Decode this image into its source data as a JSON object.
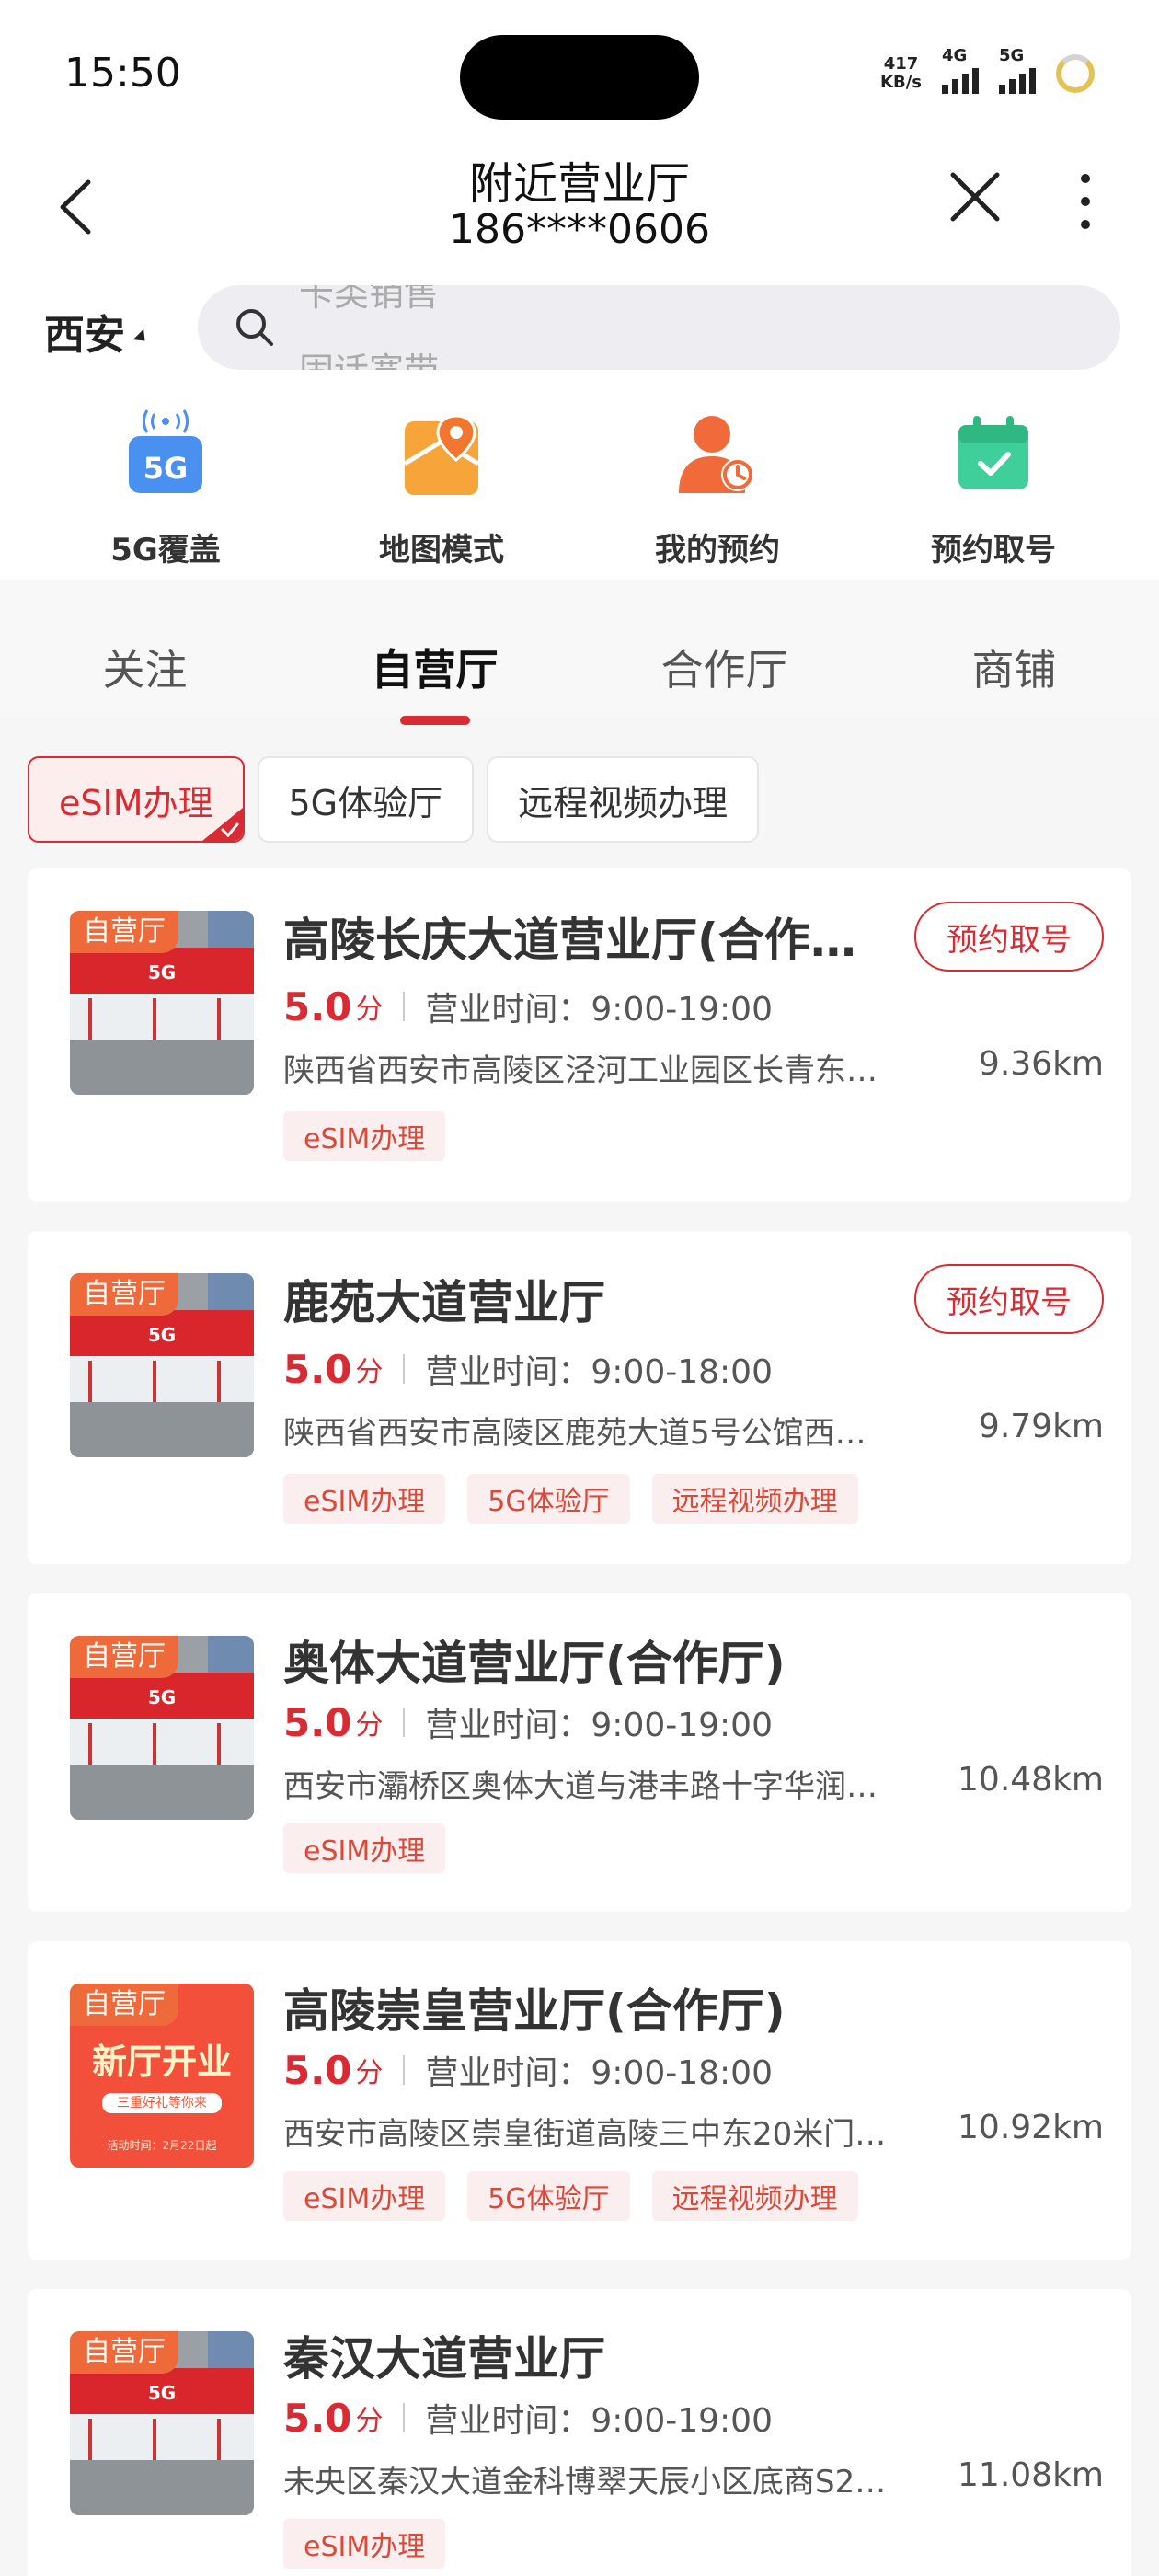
{
  "status_bar": {
    "time": "15:50",
    "net_speed_value": "417",
    "net_speed_unit": "KB/s",
    "sim1_label": "4G",
    "sim2_label": "5G"
  },
  "header": {
    "title": "附近营业厅",
    "subtitle": "186****0606"
  },
  "search": {
    "city": "西安",
    "hint_prev": "卡类销售",
    "hint_next": "固话宽带"
  },
  "quick_entries": [
    {
      "label": "5G覆盖",
      "icon": "5g-signal-icon"
    },
    {
      "label": "地图模式",
      "icon": "map-icon"
    },
    {
      "label": "我的预约",
      "icon": "user-clock-icon"
    },
    {
      "label": "预约取号",
      "icon": "calendar-check-icon"
    }
  ],
  "tabs": [
    {
      "label": "关注",
      "active": false
    },
    {
      "label": "自营厅",
      "active": true
    },
    {
      "label": "合作厅",
      "active": false
    },
    {
      "label": "商铺",
      "active": false
    }
  ],
  "filters": [
    {
      "label": "eSIM办理",
      "active": true
    },
    {
      "label": "5G体验厅",
      "active": false
    },
    {
      "label": "远程视频办理",
      "active": false
    }
  ],
  "colors": {
    "accent": "#d92b33",
    "badge": "#ef6a3a"
  },
  "stores": [
    {
      "badge": "自营厅",
      "name": "高陵长庆大道营业厅(合作…",
      "reserve": "预约取号",
      "score": "5.0",
      "score_unit": "分",
      "hours": "营业时间：9:00-19:00",
      "address": "陕西省西安市高陵区泾河工业园区长青东…",
      "distance": "9.36km",
      "tags": [
        "eSIM办理"
      ]
    },
    {
      "badge": "自营厅",
      "name": "鹿苑大道营业厅",
      "reserve": "预约取号",
      "score": "5.0",
      "score_unit": "分",
      "hours": "营业时间：9:00-18:00",
      "address": "陕西省西安市高陵区鹿苑大道5号公馆西…",
      "distance": "9.79km",
      "tags": [
        "eSIM办理",
        "5G体验厅",
        "远程视频办理"
      ]
    },
    {
      "badge": "自营厅",
      "name": "奥体大道营业厅(合作厅)",
      "score": "5.0",
      "score_unit": "分",
      "hours": "营业时间：9:00-19:00",
      "address": "西安市灞桥区奥体大道与港丰路十字华润…",
      "distance": "10.48km",
      "tags": [
        "eSIM办理"
      ]
    },
    {
      "badge": "自营厅",
      "name": "高陵崇皇营业厅(合作厅)",
      "score": "5.0",
      "score_unit": "分",
      "hours": "营业时间：9:00-18:00",
      "address": "西安市高陵区崇皇街道高陵三中东20米门…",
      "distance": "10.92km",
      "tags": [
        "eSIM办理",
        "5G体验厅",
        "远程视频办理"
      ],
      "poster_title": "新厅开业",
      "poster_sub": "三重好礼等你来",
      "poster_date": "活动时间：2月22日起"
    },
    {
      "badge": "自营厅",
      "name": "秦汉大道营业厅",
      "score": "5.0",
      "score_unit": "分",
      "hours": "营业时间：9:00-19:00",
      "address": "未央区秦汉大道金科博翠天辰小区底商S2…",
      "distance": "11.08km",
      "tags": [
        "eSIM办理"
      ]
    }
  ]
}
